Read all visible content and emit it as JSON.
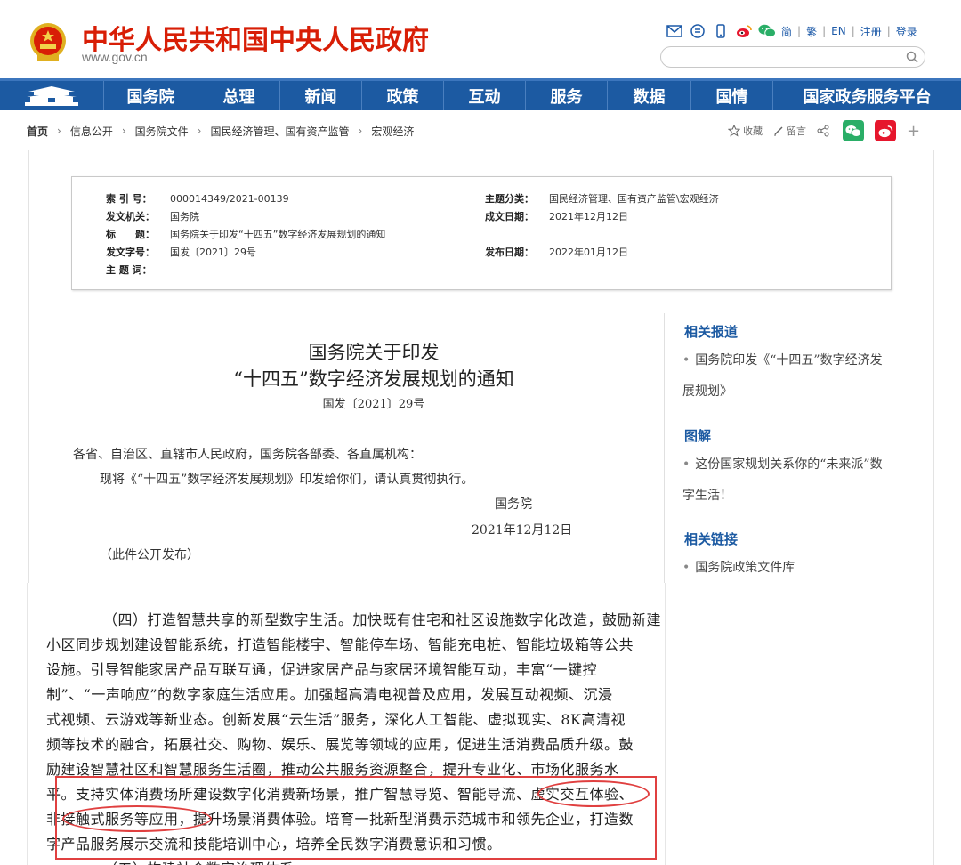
{
  "header": {
    "site_title": "中华人民共和国中央人民政府",
    "site_url": "www.gov.cn",
    "lang_links": [
      "简",
      "繁",
      "EN",
      "注册",
      "登录"
    ]
  },
  "nav": {
    "items": [
      "国务院",
      "总理",
      "新闻",
      "政策",
      "互动",
      "服务",
      "数据",
      "国情",
      "国家政务服务平台"
    ]
  },
  "breadcrumb": [
    "首页",
    "信息公开",
    "国务院文件",
    "国民经济管理、国有资产监管",
    "宏观经济"
  ],
  "actions": {
    "collect": "收藏",
    "comment": "留言"
  },
  "meta": {
    "index_label": "索 引 号：",
    "index_value": "000014349/2021-00139",
    "topic_label": "主题分类：",
    "topic_value": "国民经济管理、国有资产监管\\宏观经济",
    "issuer_label": "发文机关：",
    "issuer_value": "国务院",
    "date_label": "成文日期：",
    "date_value": "2021年12月12日",
    "title_label": "标　　题：",
    "title_value": "国务院关于印发“十四五”数字经济发展规划的通知",
    "docno_label": "发文字号：",
    "docno_value": "国发〔2021〕29号",
    "pubdate_label": "发布日期：",
    "pubdate_value": "2022年01月12日",
    "keywords_label": "主 题 词："
  },
  "article": {
    "title_line1": "国务院关于印发",
    "title_line2": "“十四五”数字经济发展规划的通知",
    "doc_no": "国发〔2021〕29号",
    "salutation": "各省、自治区、直辖市人民政府，国务院各部委、各直属机构：",
    "body": "现将《“十四五”数字经济发展规划》印发给你们，请认真贯彻执行。",
    "signer": "国务院",
    "sign_date": "2021年12月12日",
    "note": "（此件公开发布）"
  },
  "sidebar": {
    "related_reports_title": "相关报道",
    "related_reports_link": "国务院印发《“十四五”数字经济发展规划》",
    "graphics_title": "图解",
    "graphics_link": "这份国家规划关系你的“未来派”数字生活！",
    "related_links_title": "相关链接",
    "related_links_link": "国务院政策文件库"
  },
  "excerpt": {
    "lines": [
      "（四）打造智慧共享的新型数字生活。加快既有住宅和社区设施数字化改造，鼓励新建",
      "小区同步规划建设智能系统，打造智能楼宇、智能停车场、智能充电桩、智能垃圾箱等公共",
      "设施。引导智能家居产品互联互通，促进家居产品与家居环境智能互动，丰富“一键控",
      "制”、“一声响应”的数字家庭生活应用。加强超高清电视普及应用，发展互动视频、沉浸",
      "式视频、云游戏等新业态。创新发展“云生活”服务，深化人工智能、虚拟现实、8K高清视",
      "频等技术的融合，拓展社交、购物、娱乐、展览等领域的应用，促进生活消费品质升级。鼓",
      "励建设智慧社区和智慧服务生活圈，推动公共服务资源整合，提升专业化、市场化服务水",
      "平。支持实体消费场所建设数字化消费新场景，推广智慧导览、智能导流、虚实交互体验、",
      "非接触式服务等应用，提升场景消费体验。培育一批新型消费示范城市和领先企业，打造数",
      "字产品服务展示交流和技能培训中心，培养全民数字消费意识和习惯。",
      "（五）构建社会数字治理体系"
    ]
  },
  "colors": {
    "brand_red": "#d81e06",
    "nav_blue": "#1c5aa2",
    "highlight_red": "#e04040"
  }
}
